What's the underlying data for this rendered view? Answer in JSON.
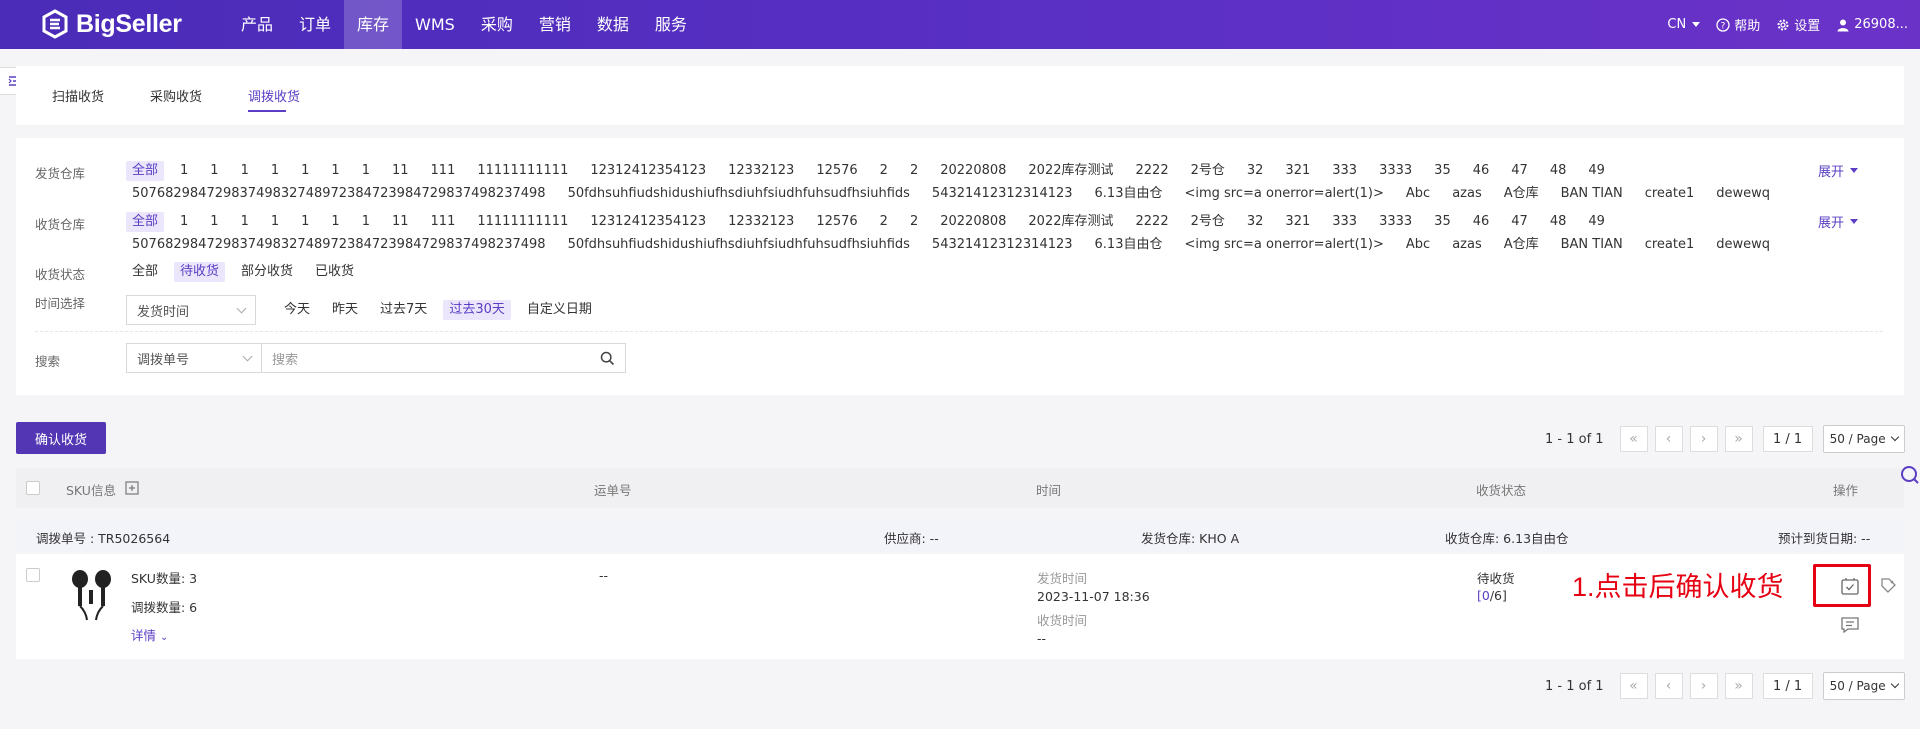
{
  "topnav": {
    "logo_text": "BigSeller",
    "menu": [
      "产品",
      "订单",
      "库存",
      "WMS",
      "采购",
      "营销",
      "数据",
      "服务"
    ],
    "active_menu_index": 2,
    "lang": "CN",
    "help": "帮助",
    "settings": "设置",
    "user": "26908..."
  },
  "tabs": [
    "扫描收货",
    "采购收货",
    "调拨收货"
  ],
  "active_tab_index": 2,
  "filters": {
    "ship_warehouse_label": "发货仓库",
    "receive_warehouse_label": "收货仓库",
    "warehouse_row1": [
      "全部",
      "1",
      "1",
      "1",
      "1",
      "1",
      "1",
      "1",
      "11",
      "111",
      "11111111111",
      "12312412354123",
      "12332123",
      "12576",
      "2",
      "2",
      "20220808",
      "2022库存测试",
      "2222",
      "2号仓",
      "32",
      "321",
      "333",
      "3333",
      "35",
      "46",
      "47",
      "48",
      "49"
    ],
    "warehouse_row2": [
      "50768298472983749832748972384723984729837498237498",
      "50fdhsuhfiudshidushiufhsdiuhfsiudhfuhsudfhsiuhfids",
      "54321412312314123",
      "6.13自由仓",
      "<img src=a onerror=alert(1)>",
      "Abc",
      "azas",
      "A仓库",
      "BAN TIAN",
      "create1",
      "dewewq"
    ],
    "expand_label": "展开",
    "status_label": "收货状态",
    "status_options": [
      "全部",
      "待收货",
      "部分收货",
      "已收货"
    ],
    "status_selected_index": 1,
    "time_label": "时间选择",
    "time_type_value": "发货时间",
    "time_options": [
      "今天",
      "昨天",
      "过去7天",
      "过去30天",
      "自定义日期"
    ],
    "time_selected_index": 3,
    "search_label": "搜索",
    "search_type_value": "调拨单号",
    "search_placeholder": "搜索"
  },
  "actions": {
    "confirm_label": "确认收货"
  },
  "pagination": {
    "range": "1 - 1 of 1",
    "page": "1 / 1",
    "page_size": "50 / Page"
  },
  "table": {
    "headers": {
      "sku": "SKU信息",
      "tracking": "运单号",
      "time": "时间",
      "status": "收货状态",
      "ops": "操作"
    }
  },
  "group": {
    "transfer_no": "调拨单号 : TR5026564",
    "supplier": "供应商: --",
    "ship_warehouse": "发货仓库:  KHO A",
    "receive_warehouse": "收货仓库:  6.13自由仓",
    "eta": "预计到货日期: --"
  },
  "item": {
    "sku_count": "SKU数量: 3",
    "transfer_qty": "调拨数量: 6",
    "details": "详情",
    "tracking": "--",
    "ship_time_label": "发货时间",
    "ship_time": "2023-11-07 18:36",
    "receive_time_label": "收货时间",
    "receive_time": "--",
    "status": "待收货",
    "progress_open": "[",
    "progress_done": "0",
    "progress_sep": "/6]"
  },
  "annotation": "1.点击后确认收货",
  "colors": {
    "primary": "#5336b4",
    "accent": "#5b3ec4",
    "annotation": "#e60012"
  }
}
